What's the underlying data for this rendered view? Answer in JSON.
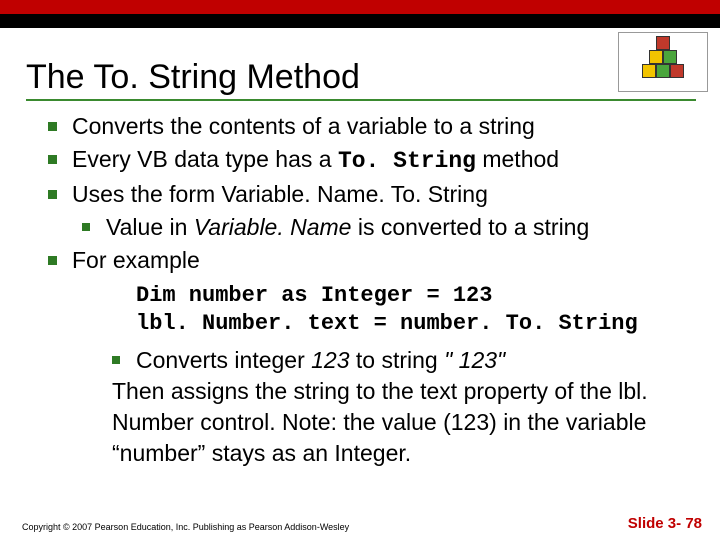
{
  "title": "The To. String Method",
  "bullets": {
    "b1": "Converts the contents of a variable to a string",
    "b2_pre": "Every VB data type has a ",
    "b2_code": "To. String",
    "b2_post": " method",
    "b3": "Uses the form Variable. Name. To. String",
    "b3_sub_pre": "Value in ",
    "b3_sub_ital": "Variable. Name",
    "b3_sub_post": " is converted to a string",
    "b4": "For example"
  },
  "code": {
    "l1": "Dim number as Integer = 123",
    "l2": "lbl. Number. text = number. To. String"
  },
  "tail": {
    "sub_pre": "Converts integer ",
    "sub_ital1": "123",
    "sub_mid": " to string ",
    "sub_ital2": "\" 123\"",
    "rest": "Then assigns the string to the text property of the lbl. Number control. Note: the value (123) in the variable “number” stays as an Integer."
  },
  "footer": "Copyright © 2007 Pearson Education, Inc. Publishing as Pearson Addison-Wesley",
  "slidenum": "Slide 3- 78"
}
